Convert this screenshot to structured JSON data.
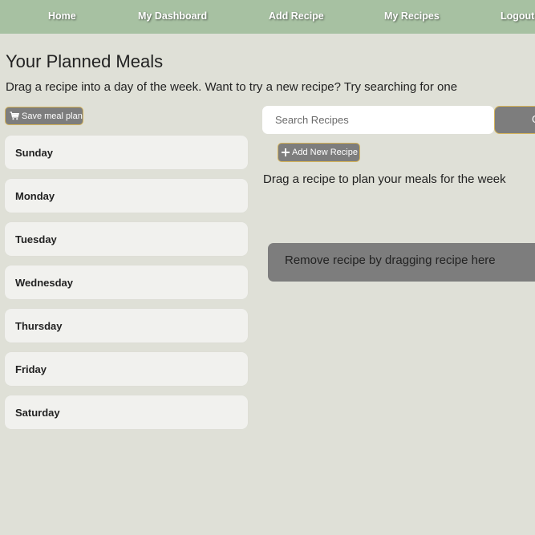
{
  "nav": {
    "items": [
      {
        "label": "Home"
      },
      {
        "label": "My Dashboard"
      },
      {
        "label": "Add Recipe"
      },
      {
        "label": "My Recipes"
      },
      {
        "label": "Logout"
      }
    ]
  },
  "page": {
    "title": "Your Planned Meals",
    "subtitle": "Drag a recipe into a day of the week. Want to try a new recipe? Try searching for one"
  },
  "planner": {
    "save_label": "Save meal plan",
    "days": [
      {
        "label": "Sunday"
      },
      {
        "label": "Monday"
      },
      {
        "label": "Tuesday"
      },
      {
        "label": "Wednesday"
      },
      {
        "label": "Thursday"
      },
      {
        "label": "Friday"
      },
      {
        "label": "Saturday"
      }
    ]
  },
  "search": {
    "placeholder": "Search Recipes",
    "button_label": "G"
  },
  "recipes": {
    "add_label": "Add New Recipe",
    "hint": "Drag a recipe to plan your meals for the week",
    "remove_zone_label": "Remove recipe by dragging recipe here"
  },
  "colors": {
    "background": "#dfe0d7",
    "navbar": "#a7c1a2",
    "button": "#7d7d7d",
    "button_border": "#d4b35a",
    "day_card": "#f1f1ee"
  }
}
